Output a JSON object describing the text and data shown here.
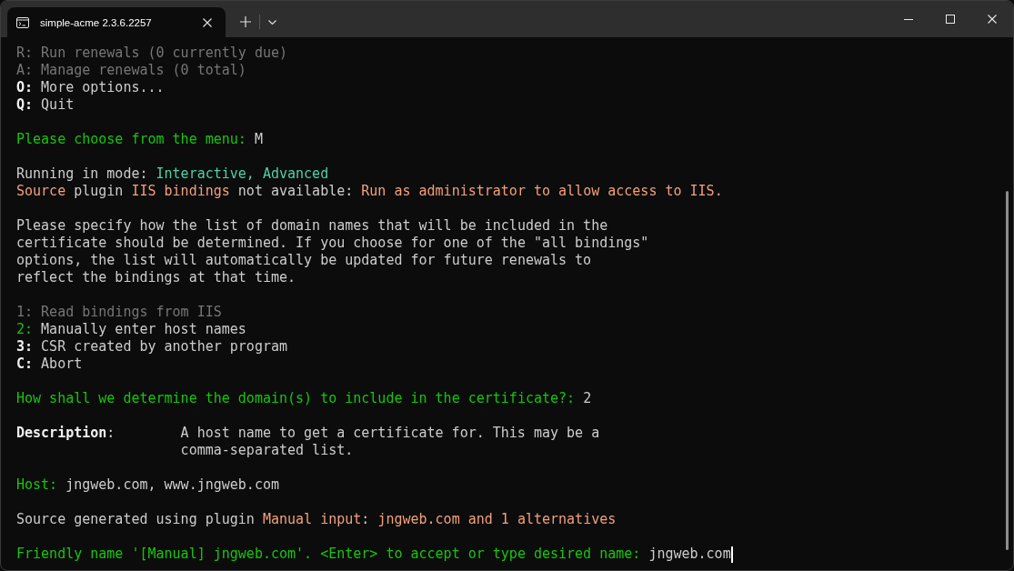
{
  "window": {
    "tabs": [
      {
        "title": "simple-acme 2.3.6.2257",
        "selected": true
      }
    ]
  },
  "terminal": {
    "blocks": [
      {
        "kind": "menu",
        "items": [
          {
            "key": "R:",
            "label": "Run renewals (0 currently due)",
            "disabled": true,
            "default": false
          },
          {
            "key": "A:",
            "label": "Manage renewals (0 total)",
            "disabled": true,
            "default": false
          },
          {
            "key": "O:",
            "label": "More options...",
            "disabled": false,
            "default": false
          },
          {
            "key": "Q:",
            "label": "Quit",
            "disabled": false,
            "default": false
          }
        ]
      },
      {
        "kind": "prompt",
        "question": "Please choose from the menu:",
        "answer": "M",
        "cursor": false
      },
      {
        "kind": "messages",
        "lines": [
          {
            "segments": [
              {
                "text": "Running in mode: ",
                "kind": "plain"
              },
              {
                "text": "Interactive, Advanced",
                "kind": "accent"
              }
            ]
          },
          {
            "segments": [
              {
                "text": "Source",
                "kind": "warning"
              },
              {
                "text": " plugin ",
                "kind": "plain"
              },
              {
                "text": "IIS bindings",
                "kind": "warning"
              },
              {
                "text": " not available: ",
                "kind": "plain"
              },
              {
                "text": "Run as administrator to allow access to IIS.",
                "kind": "warning"
              }
            ]
          }
        ]
      },
      {
        "kind": "paragraph",
        "text": "Please specify how the list of domain names that will be included in the certificate should be determined. If you choose for one of the \"all bindings\" options, the list will automatically be updated for future renewals to reflect the bindings at that time."
      },
      {
        "kind": "menu",
        "items": [
          {
            "key": "1:",
            "label": "Read bindings from IIS",
            "disabled": true,
            "default": false
          },
          {
            "key": "2:",
            "label": "Manually enter host names",
            "disabled": false,
            "default": true
          },
          {
            "key": "3:",
            "label": "CSR created by another program",
            "disabled": false,
            "default": false
          },
          {
            "key": "C:",
            "label": "Abort",
            "disabled": false,
            "default": false
          }
        ]
      },
      {
        "kind": "prompt",
        "question": "How shall we determine the domain(s) to include in the certificate?:",
        "answer": "2",
        "cursor": false
      },
      {
        "kind": "field",
        "label": "**Description**:",
        "value": "A host name to get a certificate for. This may be a comma-separated list."
      },
      {
        "kind": "prompt",
        "question": "Host:",
        "answer": "jngweb.com, www.jngweb.com",
        "cursor": false
      },
      {
        "kind": "messages",
        "lines": [
          {
            "segments": [
              {
                "text": "Source generated using plugin ",
                "kind": "plain"
              },
              {
                "text": "Manual input",
                "kind": "warning"
              },
              {
                "text": ": ",
                "kind": "plain"
              },
              {
                "text": "jngweb.com and 1 alternatives",
                "kind": "warning"
              }
            ]
          }
        ]
      },
      {
        "kind": "prompt",
        "question": "Friendly name '[Manual] jngweb.com'. <Enter> to accept or type desired name:",
        "answer": "jngweb.com",
        "cursor": true
      }
    ]
  }
}
